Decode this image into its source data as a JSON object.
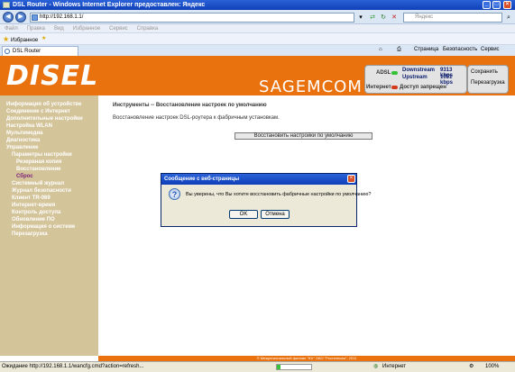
{
  "window": {
    "title": "DSL Router - Windows Internet Explorer предоставлен: Яндекс",
    "address": "http://192.168.1.1/",
    "search_placeholder": "Яндекс"
  },
  "menubar": [
    "Файл",
    "Правка",
    "Вид",
    "Избранное",
    "Сервис",
    "Справка"
  ],
  "favorites": {
    "label": "Избранное"
  },
  "tab": {
    "label": "DSL Router"
  },
  "commandbar": {
    "page": "Страница",
    "safety": "Безопасность",
    "tools": "Сервис"
  },
  "header": {
    "logo": "DISEL",
    "brand": "SAGEMCOM",
    "adsl_label": "ADSL",
    "downstream_label": "Downstream",
    "downstream_value": "9313 kbps",
    "upstream_label": "Upstream",
    "upstream_value": "1051 kbps",
    "internet_label": "Интернет",
    "access_label": "Доступ запрещен",
    "save_button": "Сохранить",
    "reboot_button": "Перезагрузка",
    "colors": {
      "header_bg": "#e9720f",
      "adsl_led": "#35c235",
      "internet_led": "#d43a1a"
    }
  },
  "sidebar": {
    "items": [
      {
        "label": "Информация об устройстве"
      },
      {
        "label": "Соединение с Интернет"
      },
      {
        "label": "Дополнительные настройки"
      },
      {
        "label": "Настройка WLAN"
      },
      {
        "label": "Мультимедиа"
      },
      {
        "label": "Диагностика"
      },
      {
        "label": "Управление"
      },
      {
        "label": "Параметры настройки"
      },
      {
        "label": "Резервная копия"
      },
      {
        "label": "Восстановление"
      },
      {
        "label": "Сброс"
      },
      {
        "label": "Системный журнал"
      },
      {
        "label": "Журнал безопасности"
      },
      {
        "label": "Клиент TR-069"
      },
      {
        "label": "Интернет-время"
      },
      {
        "label": "Контроль доступа"
      },
      {
        "label": "Обновление ПО"
      },
      {
        "label": "Информация о системе"
      },
      {
        "label": "Перезагрузка"
      }
    ]
  },
  "main": {
    "breadcrumb": "Инструменты -- Восстановление настроек по умолчанию",
    "description": "Восстановление настроек DSL-роутера к фабричным установкам.",
    "restore_button": "Восстановить настройки по умолчанию",
    "footer": "© Межрегиональный филиал \"Юг\" ОАО \"Ростелеком\", 2011"
  },
  "dialog": {
    "title": "Сообщение с веб-страницы",
    "message": "Вы уверены, что Вы хотите восстановить фабричные настройки по умолчанию?",
    "ok": "OK",
    "cancel": "Отмена"
  },
  "statusbar": {
    "text": "Ожидание http://192.168.1.1/wancfg.cmd?action=refresh...",
    "zone": "Интернет",
    "zoom": "100%"
  }
}
